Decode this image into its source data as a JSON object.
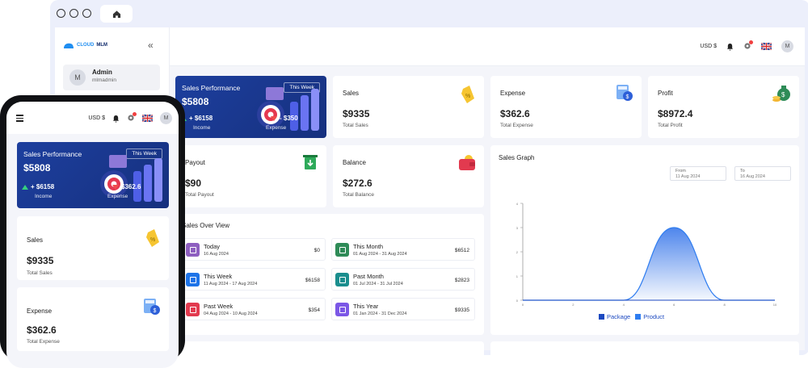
{
  "sidebar": {
    "logo_a": "CLOUD",
    "logo_b": "MLM",
    "admin_name": "Admin",
    "admin_user": "mlmadmin",
    "avatar": "M"
  },
  "topbar": {
    "currency": "USD $",
    "avatar": "M"
  },
  "perf": {
    "title": "Sales Performance",
    "value": "$5808",
    "week": "This Week",
    "income_value": "+ $6158",
    "income_label": "Income",
    "expense_value": "- $350",
    "expense_label": "Expense"
  },
  "cards": {
    "sales": {
      "title": "Sales",
      "value": "$9335",
      "sub": "Total Sales"
    },
    "expense": {
      "title": "Expense",
      "value": "$362.6",
      "sub": "Total Expense"
    },
    "profit": {
      "title": "Profit",
      "value": "$8972.4",
      "sub": "Total Profit"
    },
    "payout": {
      "title": "Payout",
      "value": "$90",
      "sub": "Total Payout"
    },
    "balance": {
      "title": "Balance",
      "value": "$272.6",
      "sub": "Total Balance"
    }
  },
  "overview": {
    "title": "Sales Over View",
    "items": [
      {
        "name": "Today",
        "date": "16 Aug 2024",
        "amount": "$0",
        "color": "#8e5fc0"
      },
      {
        "name": "This Month",
        "date": "01 Aug 2024 - 31 Aug 2024",
        "amount": "$6512",
        "color": "#2e8b57"
      },
      {
        "name": "This Week",
        "date": "11 Aug 2024 - 17 Aug 2024",
        "amount": "$6158",
        "color": "#1e74e8"
      },
      {
        "name": "Past Month",
        "date": "01 Jul 2024 - 31 Jul 2024",
        "amount": "$2823",
        "color": "#1a8e8e"
      },
      {
        "name": "Past Week",
        "date": "04 Aug 2024 - 10 Aug 2024",
        "amount": "$354",
        "color": "#e23a4f"
      },
      {
        "name": "This Year",
        "date": "01 Jan 2024 - 31 Dec 2024",
        "amount": "$9335",
        "color": "#7b57e6"
      }
    ]
  },
  "graph": {
    "title": "Sales Graph",
    "from_label": "From",
    "from_date": "11 Aug 2024",
    "to_label": "To",
    "to_date": "16 Aug 2024",
    "legend_package": "Package",
    "legend_product": "Product"
  },
  "chart_data": {
    "type": "area",
    "title": "Sales Graph",
    "x": [
      0,
      2,
      4,
      6,
      8,
      10
    ],
    "xticks": [
      "0",
      "2",
      "4",
      "6",
      "8",
      "10"
    ],
    "yticks": [
      "0",
      "1",
      "2",
      "3",
      "4"
    ],
    "ylim": [
      0,
      4
    ],
    "xlim": [
      0,
      10
    ],
    "series": [
      {
        "name": "Package",
        "values": [
          0,
          0,
          0,
          0,
          0,
          0
        ],
        "color": "#1c49c0"
      },
      {
        "name": "Product",
        "values": [
          0,
          0,
          0,
          3,
          0,
          0
        ],
        "color": "#2f7df0"
      }
    ],
    "legend": "bottom"
  },
  "phone": {
    "currency": "USD $",
    "avatar": "M",
    "perf_title": "Sales Performance",
    "perf_value": "$5808",
    "week": "This Week",
    "income_value": "+ $6158",
    "income_label": "Income",
    "expense_value": "$362.6",
    "expense_label": "Expense",
    "sales_title": "Sales",
    "sales_value": "$9335",
    "sales_sub": "Total Sales",
    "expense_title": "Expense",
    "expense_sub": "Total Expense"
  }
}
